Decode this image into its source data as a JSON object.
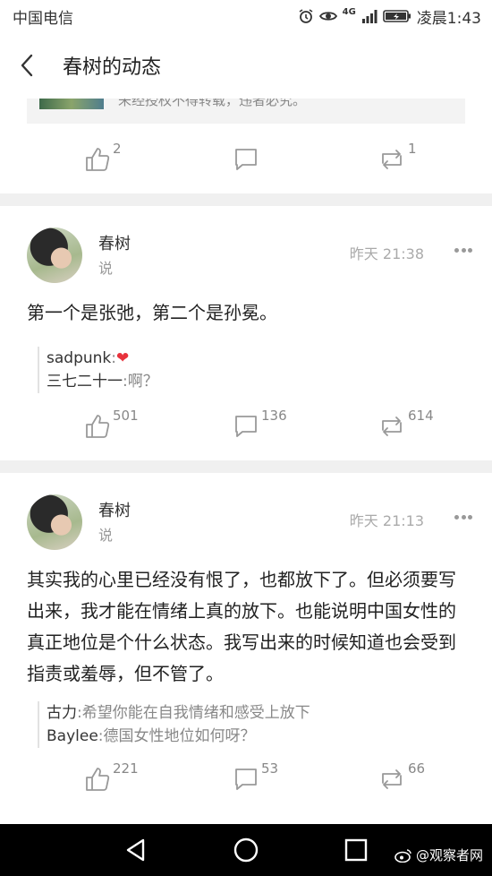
{
  "status_bar": {
    "carrier": "中国电信",
    "network": "4G",
    "time": "凌晨1:43"
  },
  "header": {
    "title": "春树的动态"
  },
  "previous_post": {
    "quote_text": "未经授权不得转载，违者必究。",
    "like_count": "2",
    "comment_count": "",
    "repost_count": "1"
  },
  "posts": [
    {
      "author": "春树",
      "verb": "说",
      "time": "昨天 21:38",
      "text": "第一个是张弛，第二个是孙冕。",
      "comments": [
        {
          "user": "sadpunk",
          "text": "❤"
        },
        {
          "user": "三七二十一",
          "text": "啊？"
        }
      ],
      "like_count": "501",
      "comment_count": "136",
      "repost_count": "614"
    },
    {
      "author": "春树",
      "verb": "说",
      "time": "昨天 21:13",
      "text": "其实我的心里已经没有恨了，也都放下了。但必须要写出来，我才能在情绪上真的放下。也能说明中国女性的真正地位是个什么状态。我写出来的时候知道也会受到指责或羞辱，但不管了。",
      "comments": [
        {
          "user": "古力",
          "text": "希望你能在自我情绪和感受上放下"
        },
        {
          "user": "Baylee",
          "text": "德国女性地位如何呀？"
        }
      ],
      "like_count": "221",
      "comment_count": "53",
      "repost_count": "66"
    }
  ],
  "watermark": "@观察者网",
  "colors": {
    "background": "#ffffff",
    "separator": "#f0f0f0",
    "muted_text": "#888888",
    "heart": "#e8323c",
    "nav_bar": "#000000"
  }
}
